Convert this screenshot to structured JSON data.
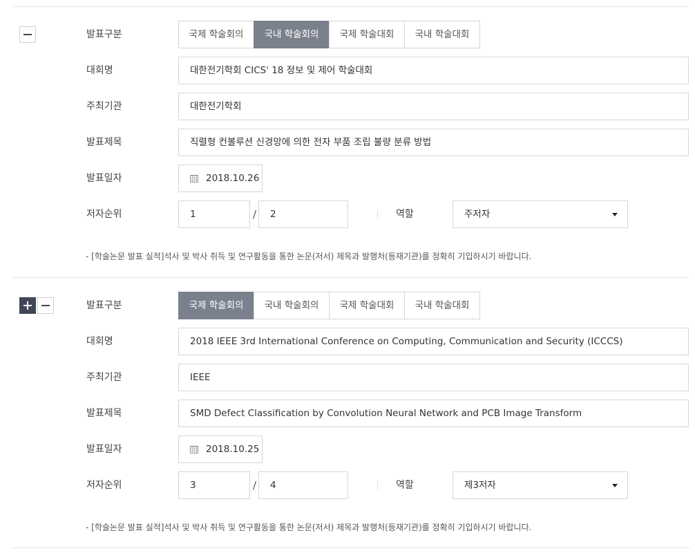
{
  "entries": [
    {
      "type_label": "발표구분",
      "type_options": [
        "국제 학술회의",
        "국내 학술회의",
        "국제 학술대회",
        "국내 학술대회"
      ],
      "type_selected": "국내 학술회의",
      "conference_label": "대회명",
      "conference_value": "대한전기학회 CICS' 18 정보 및 제어 학술대회",
      "host_label": "주최기관",
      "host_value": "대한전기학회",
      "title_label": "발표제목",
      "title_value": "직렬형 컨볼루션 신경망에 의한 전자 부품 조립 불량 분류 방법",
      "date_label": "발표일자",
      "date_value": "2018.10.26",
      "author_order_label": "저자순위",
      "author_order": "1",
      "author_total": "2",
      "author_slash": "/",
      "role_label": "역할",
      "role_value": "주저자",
      "note": "- [학술논문 발표 실적]석사 및 박사 취득 및 연구활동을 통한 논문(저서) 제목과 발행처(등재기관)를 정확히 기입하시기 바랍니다."
    },
    {
      "type_label": "발표구분",
      "type_options": [
        "국제 학술회의",
        "국내 학술회의",
        "국제 학술대회",
        "국내 학술대회"
      ],
      "type_selected": "국제 학술회의",
      "conference_label": "대회명",
      "conference_value": "2018 IEEE 3rd International Conference on Computing, Communication and Security (ICCCS)",
      "host_label": "주최기관",
      "host_value": "IEEE",
      "title_label": "발표제목",
      "title_value": "SMD Defect Classification by Convolution Neural Network and PCB Image Transform",
      "date_label": "발표일자",
      "date_value": "2018.10.25",
      "author_order_label": "저자순위",
      "author_order": "3",
      "author_total": "4",
      "author_slash": "/",
      "role_label": "역할",
      "role_value": "제3저자",
      "note": "- [학술논문 발표 실적]석사 및 박사 취득 및 연구활동을 통한 논문(저서) 제목과 발행처(등재기관)를 정확히 기입하시기 바랍니다."
    }
  ],
  "colors": {
    "active_segment": "#7b818c",
    "add_button": "#3f4656",
    "border": "#d6d6d6"
  }
}
